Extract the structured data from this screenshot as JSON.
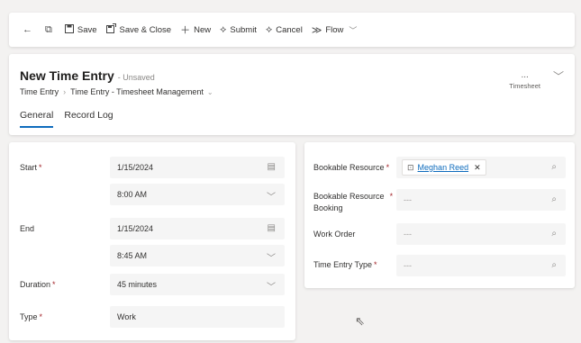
{
  "toolbar": {
    "back_icon": "arrow-left-icon",
    "popout_icon": "open-in-window-icon",
    "save": "Save",
    "save_close": "Save & Close",
    "new": "New",
    "submit": "Submit",
    "cancel": "Cancel",
    "flow": "Flow"
  },
  "header": {
    "title": "New Time Entry",
    "status": "- Unsaved",
    "breadcrumb": [
      "Time Entry",
      "Time Entry - Timesheet Management"
    ],
    "right_dots": "...",
    "right_label": "Timesheet",
    "tabs": [
      {
        "label": "General",
        "active": true
      },
      {
        "label": "Record Log",
        "active": false
      }
    ]
  },
  "form_left": {
    "start_label": "Start",
    "start_date": "1/15/2024",
    "start_time": "8:00 AM",
    "end_label": "End",
    "end_date": "1/15/2024",
    "end_time": "8:45 AM",
    "duration_label": "Duration",
    "duration_value": "45 minutes",
    "type_label": "Type",
    "type_value": "Work"
  },
  "form_right": {
    "resource_label": "Bookable Resource",
    "resource_value": "Meghan Reed",
    "booking_label_1": "Bookable Resource",
    "booking_label_2": "Booking",
    "booking_placeholder": "---",
    "work_order_label": "Work Order",
    "work_order_placeholder": "---",
    "entry_type_label": "Time Entry Type",
    "entry_type_placeholder": "---"
  },
  "required_marker": "*",
  "colors": {
    "accent": "#0f6cbd",
    "required": "#a4262c",
    "field_bg": "#f5f5f5"
  }
}
